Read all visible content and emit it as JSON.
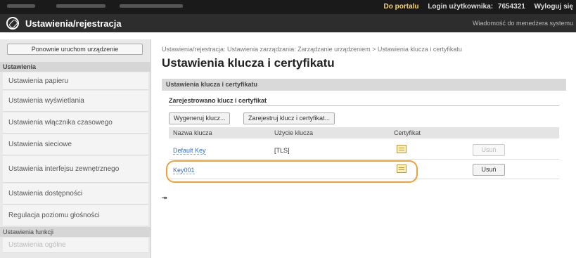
{
  "topbar": {
    "portal_link": "Do portalu",
    "login_label": "Login użytkownika:",
    "login_value": "7654321",
    "logout_link": "Wyloguj się"
  },
  "titlebar": {
    "title": "Ustawienia/rejestracja",
    "message_link": "Wiadomość do menedżera systemu"
  },
  "sidebar": {
    "restart_button": "Ponownie uruchom urządzenie",
    "section1": "Ustawienia",
    "items": [
      "Ustawienia papieru",
      "Ustawienia wyświetlania",
      "Ustawienia włącznika czasowego",
      "Ustawienia sieciowe",
      "Ustawienia interfejsu zewnętrznego",
      "Ustawienia dostępności",
      "Regulacja poziomu głośności"
    ],
    "section2": "Ustawienia funkcji",
    "faded_item": "Ustawienia ogólne"
  },
  "main": {
    "breadcrumb": "Ustawienia/rejestracja: Ustawienia zarządzania: Zarządzanie urządzeniem > Ustawienia klucza i certyfikatu",
    "heading": "Ustawienia klucza i certyfikatu",
    "section_bar": "Ustawienia klucza i certyfikatu",
    "registered_label": "Zarejestrowano klucz i certyfikat",
    "generate_button": "Wygeneruj klucz...",
    "register_button": "Zarejestruj klucz i certyfikat...",
    "columns": {
      "key_name": "Nazwa klucza",
      "key_usage": "Użycie klucza",
      "certificate": "Certyfikat"
    },
    "rows": [
      {
        "name": "Default Key",
        "usage": "[TLS]",
        "delete": "Usuń"
      },
      {
        "name": "Key001",
        "usage": "",
        "delete": "Usuń"
      }
    ],
    "to_top": "⯮"
  },
  "colors": {
    "highlight": "#f0a13a",
    "link": "#3a6cb4",
    "topbar_bg": "#1a1a1a"
  }
}
